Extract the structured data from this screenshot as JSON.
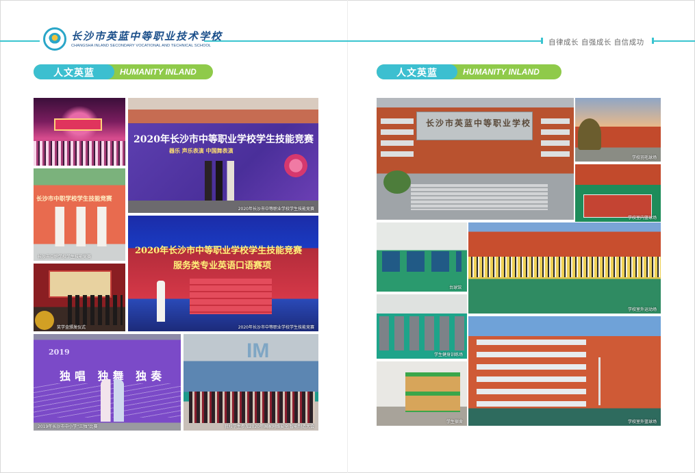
{
  "header": {
    "school_name_cn": "长沙市英蓝中等职业技术学校",
    "school_name_en": "CHANGSHA INLAND SECONDARY VOCATIONAL AND TECHNICAL SCHOOL",
    "motto": "自律成长  自强成长  自信成功"
  },
  "left_page": {
    "section": {
      "title_cn": "人文英蓝",
      "title_en": "HUMANITY INLAND"
    },
    "photos": [
      {
        "caption": ""
      },
      {
        "caption": "2020年长沙市中等职业学校学生技能竞赛",
        "text_title": "2020年长沙市中等职业学校学生技能竞赛",
        "text_sub": "器乐 声乐表演 中国舞表演"
      },
      {
        "caption": "长沙市中职学校学生技能竞赛",
        "text_title": "长沙市中职学校学生技能竞赛"
      },
      {
        "caption": "2020年长沙市中等职业学校学生技能竞赛",
        "text_title": "2020年长沙市中等职业学校学生技能竞赛",
        "text_sub": "服务类专业英语口语赛项"
      },
      {
        "caption": "奖学金颁发仪式"
      },
      {
        "caption": "2019年长沙市中小学“三独”比赛",
        "text_year": "2019",
        "text_big": "独唱  独舞  独奏"
      },
      {
        "caption": "我校学生参加2020年国家网络安全 智能制造大会"
      }
    ]
  },
  "right_page": {
    "section": {
      "title_cn": "人文英蓝",
      "title_en": "HUMANITY INLAND"
    },
    "photos": [
      {
        "caption": "",
        "text_gate": "长沙市英蓝中等职业学校"
      },
      {
        "caption": "学校羽毛球场"
      },
      {
        "caption": "学校室内篮球场"
      },
      {
        "caption": "台球馆"
      },
      {
        "caption": "学校室外运动场"
      },
      {
        "caption": "学生健身训练场"
      },
      {
        "caption": "学校室外篮球场"
      },
      {
        "caption": "学生宿舍"
      }
    ]
  },
  "colors": {
    "teal": "#3cbfd0",
    "green": "#8fca4a",
    "navy": "#1b4f8a"
  }
}
